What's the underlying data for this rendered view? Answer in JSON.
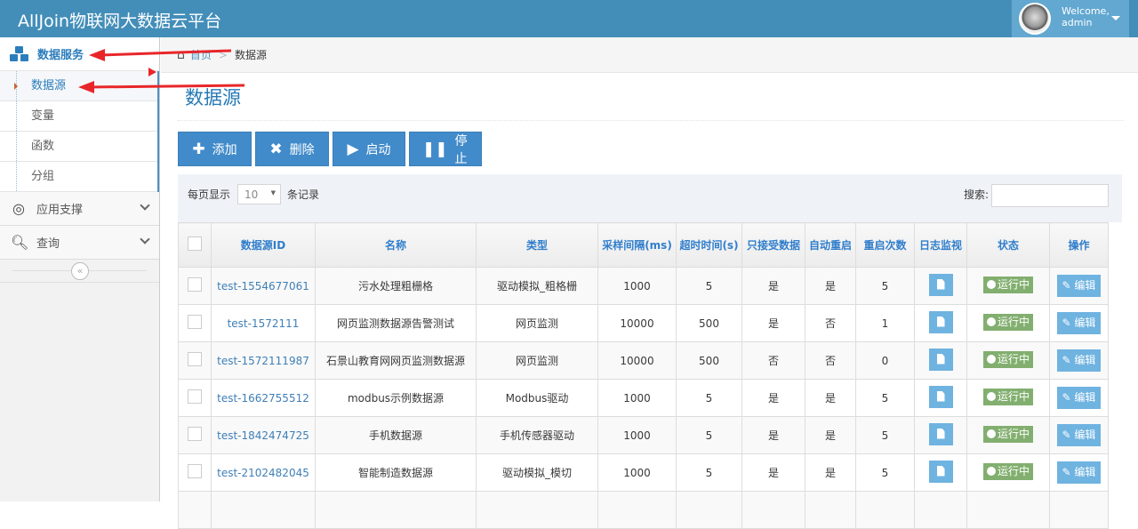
{
  "header": {
    "brand": "AllJoin物联网大数据云平台",
    "welcome": "Welcome,",
    "user": "admin"
  },
  "sidebar": {
    "main": "数据服务",
    "sub": [
      "数据源",
      "变量",
      "函数",
      "分组"
    ],
    "nav": [
      "应用支撑",
      "查询"
    ],
    "collapse": "«"
  },
  "breadcrumb": {
    "home": "首页",
    "sep": ">",
    "current": "数据源"
  },
  "page_title": "数据源",
  "toolbar": {
    "add": "添加",
    "delete": "删除",
    "start": "启动",
    "stop": "停止"
  },
  "filter": {
    "per_page_label": "每页显示",
    "per_page_value": "10",
    "records_label": "条记录",
    "search_label": "搜索:",
    "search_value": ""
  },
  "table": {
    "headers": [
      "数据源ID",
      "名称",
      "类型",
      "采样间隔(ms)",
      "超时时间(s)",
      "只接受数据",
      "自动重启",
      "重启次数",
      "日志监视",
      "状态",
      "操作"
    ],
    "rows": [
      [
        "test-1554677061",
        "污水处理粗栅格",
        "驱动模拟_粗格栅",
        "1000",
        "5",
        "是",
        "是",
        "5",
        "运行中",
        "编辑"
      ],
      [
        "test-1572111",
        "网页监测数据源告警测试",
        "网页监测",
        "10000",
        "500",
        "是",
        "否",
        "1",
        "运行中",
        "编辑"
      ],
      [
        "test-1572111987",
        "石景山教育网网页监测数据源",
        "网页监测",
        "10000",
        "500",
        "否",
        "否",
        "0",
        "运行中",
        "编辑"
      ],
      [
        "test-1662755512",
        "modbus示例数据源",
        "Modbus驱动",
        "1000",
        "5",
        "是",
        "是",
        "5",
        "运行中",
        "编辑"
      ],
      [
        "test-1842474725",
        "手机数据源",
        "手机传感器驱动",
        "1000",
        "5",
        "是",
        "是",
        "5",
        "运行中",
        "编辑"
      ],
      [
        "test-2102482045",
        "智能制造数据源",
        "驱动模拟_模切",
        "1000",
        "5",
        "是",
        "是",
        "5",
        "运行中",
        "编辑"
      ]
    ]
  },
  "colors": {
    "header": "#438eb9",
    "primary": "#428bca",
    "running": "#82af6f",
    "annotation": "#e8262a"
  }
}
